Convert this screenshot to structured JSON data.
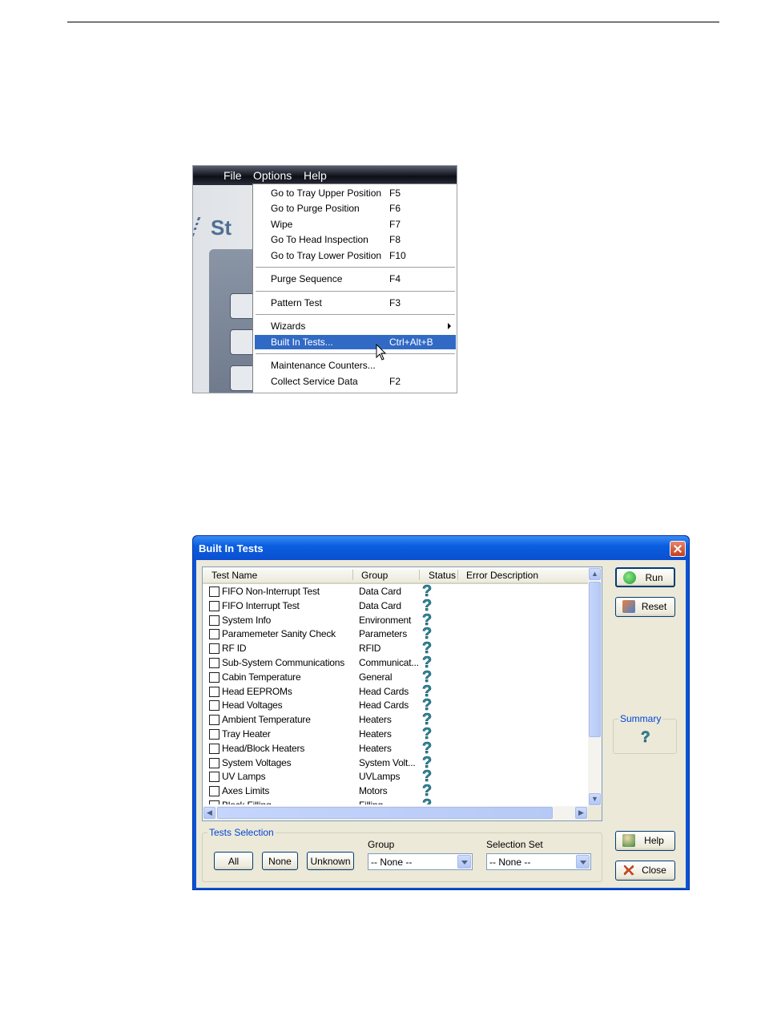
{
  "menu_screenshot": {
    "menubar": [
      "File",
      "Options",
      "Help"
    ],
    "app_logo_text": "St",
    "items": [
      {
        "label": "Go to Tray Upper Position",
        "shortcut": "F5"
      },
      {
        "label": "Go to Purge Position",
        "shortcut": "F6"
      },
      {
        "label": "Wipe",
        "shortcut": "F7"
      },
      {
        "label": "Go To Head Inspection",
        "shortcut": "F8"
      },
      {
        "label": "Go to Tray Lower Position",
        "shortcut": "F10"
      },
      {
        "label": "Purge Sequence",
        "shortcut": "F4"
      },
      {
        "label": "Pattern Test",
        "shortcut": "F3"
      },
      {
        "label": "Wizards",
        "shortcut": ""
      },
      {
        "label": "Built In Tests...",
        "shortcut": "Ctrl+Alt+B"
      },
      {
        "label": "Maintenance Counters...",
        "shortcut": ""
      },
      {
        "label": "Collect Service Data",
        "shortcut": "F2"
      }
    ],
    "highlighted_item": "Built In Tests...",
    "highlight_color": "#316ac5"
  },
  "dialog": {
    "title": "Built In Tests",
    "columns": [
      "Test Name",
      "Group",
      "Status",
      "Error Description"
    ],
    "status_icon": "question-mark-icon",
    "status_text": "?",
    "rows": [
      {
        "name": "FIFO Non-Interrupt Test",
        "group": "Data Card"
      },
      {
        "name": "FIFO Interrupt Test",
        "group": "Data Card"
      },
      {
        "name": "System Info",
        "group": "Environment"
      },
      {
        "name": "Paramemeter Sanity Check",
        "group": "Parameters"
      },
      {
        "name": "RF ID",
        "group": "RFID"
      },
      {
        "name": "Sub-System Communications",
        "group": "Communicat..."
      },
      {
        "name": "Cabin Temperature",
        "group": "General"
      },
      {
        "name": "Head EEPROMs",
        "group": "Head Cards"
      },
      {
        "name": "Head Voltages",
        "group": "Head Cards"
      },
      {
        "name": "Ambient Temperature",
        "group": "Heaters"
      },
      {
        "name": "Tray Heater",
        "group": "Heaters"
      },
      {
        "name": "Head/Block Heaters",
        "group": "Heaters"
      },
      {
        "name": "System Voltages",
        "group": "System Volt..."
      },
      {
        "name": "UV Lamps",
        "group": "UVLamps"
      },
      {
        "name": "Axes Limits",
        "group": "Motors"
      },
      {
        "name": "Block Filling",
        "group": "Filling"
      }
    ],
    "buttons": {
      "run": "Run",
      "reset": "Reset",
      "help": "Help",
      "close": "Close"
    },
    "summary": {
      "label": "Summary",
      "value": "?"
    },
    "tests_selection": {
      "label": "Tests Selection",
      "all": "All",
      "none": "None",
      "unknown": "Unknown",
      "group_label": "Group",
      "group_value": "-- None --",
      "set_label": "Selection Set",
      "set_value": "-- None --"
    },
    "accent_color": "#0a54d6"
  }
}
